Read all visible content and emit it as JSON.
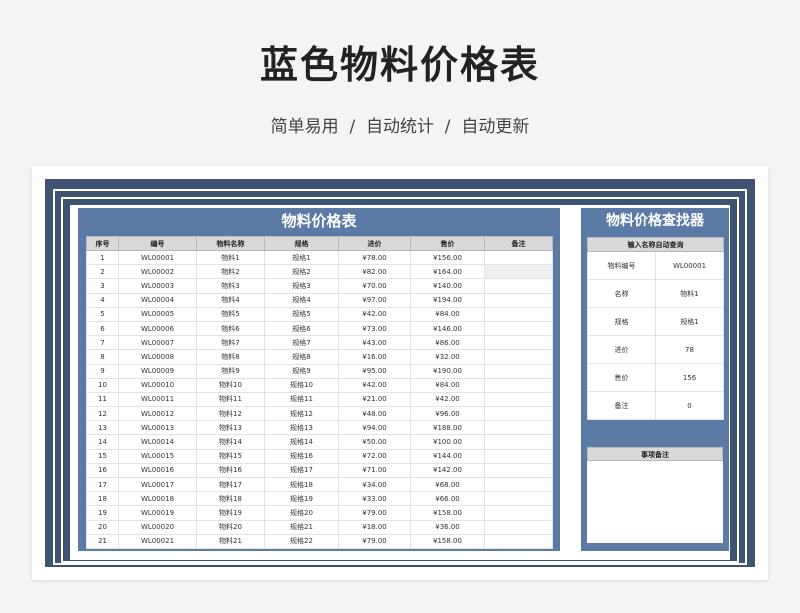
{
  "page": {
    "title": "蓝色物料价格表",
    "subtitle": "简单易用  /  自动统计  /  自动更新"
  },
  "colors": {
    "frame": "#3f5472",
    "panel": "#5b7aa5",
    "header_gray": "#d9d9d9"
  },
  "table": {
    "title": "物料价格表",
    "headers": [
      "序号",
      "编号",
      "物料名称",
      "规格",
      "进价",
      "售价",
      "备注"
    ],
    "rows": [
      [
        "1",
        "WL00001",
        "物料1",
        "规格1",
        "¥78.00",
        "¥156.00",
        ""
      ],
      [
        "2",
        "WL00002",
        "物料2",
        "规格2",
        "¥82.00",
        "¥164.00",
        ""
      ],
      [
        "3",
        "WL00003",
        "物料3",
        "规格3",
        "¥70.00",
        "¥140.00",
        ""
      ],
      [
        "4",
        "WL00004",
        "物料4",
        "规格4",
        "¥97.00",
        "¥194.00",
        ""
      ],
      [
        "5",
        "WL00005",
        "物料5",
        "规格5",
        "¥42.00",
        "¥84.00",
        ""
      ],
      [
        "6",
        "WL00006",
        "物料6",
        "规格6",
        "¥73.00",
        "¥146.00",
        ""
      ],
      [
        "7",
        "WL00007",
        "物料7",
        "规格7",
        "¥43.00",
        "¥86.00",
        ""
      ],
      [
        "8",
        "WL00008",
        "物料8",
        "规格8",
        "¥16.00",
        "¥32.00",
        ""
      ],
      [
        "9",
        "WL00009",
        "物料9",
        "规格9",
        "¥95.00",
        "¥190.00",
        ""
      ],
      [
        "10",
        "WL00010",
        "物料10",
        "规格10",
        "¥42.00",
        "¥84.00",
        ""
      ],
      [
        "11",
        "WL00011",
        "物料11",
        "规格11",
        "¥21.00",
        "¥42.00",
        ""
      ],
      [
        "12",
        "WL00012",
        "物料12",
        "规格12",
        "¥48.00",
        "¥96.00",
        ""
      ],
      [
        "13",
        "WL00013",
        "物料13",
        "规格13",
        "¥94.00",
        "¥188.00",
        ""
      ],
      [
        "14",
        "WL00014",
        "物料14",
        "规格14",
        "¥50.00",
        "¥100.00",
        ""
      ],
      [
        "15",
        "WL00015",
        "物料15",
        "规格16",
        "¥72.00",
        "¥144.00",
        ""
      ],
      [
        "16",
        "WL00016",
        "物料16",
        "规格17",
        "¥71.00",
        "¥142.00",
        ""
      ],
      [
        "17",
        "WL00017",
        "物料17",
        "规格18",
        "¥34.00",
        "¥68.00",
        ""
      ],
      [
        "18",
        "WL00018",
        "物料18",
        "规格19",
        "¥33.00",
        "¥66.00",
        ""
      ],
      [
        "19",
        "WL00019",
        "物料19",
        "规格20",
        "¥79.00",
        "¥158.00",
        ""
      ],
      [
        "20",
        "WL00020",
        "物料20",
        "规格21",
        "¥18.00",
        "¥36.00",
        ""
      ],
      [
        "21",
        "WL00021",
        "物料21",
        "规格22",
        "¥79.00",
        "¥158.00",
        ""
      ]
    ]
  },
  "finder": {
    "title": "物料价格查找器",
    "header": "输入名称自动查询",
    "fields": [
      {
        "label": "物料编号",
        "value": "WL00001"
      },
      {
        "label": "名称",
        "value": "物料1"
      },
      {
        "label": "规格",
        "value": "规格1"
      },
      {
        "label": "进价",
        "value": "78"
      },
      {
        "label": "售价",
        "value": "156"
      },
      {
        "label": "备注",
        "value": "0"
      }
    ]
  },
  "notes": {
    "header": "事项备注"
  }
}
